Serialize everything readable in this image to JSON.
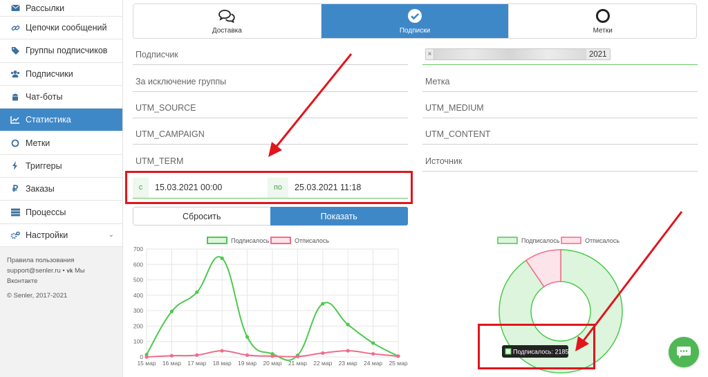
{
  "sidebar": {
    "items": [
      {
        "label": "Рассылки",
        "icon": "envelope-icon"
      },
      {
        "label": "Цепочки сообщений",
        "icon": "link-icon"
      },
      {
        "label": "Группы подписчиков",
        "icon": "tags-icon"
      },
      {
        "label": "Подписчики",
        "icon": "users-icon"
      },
      {
        "label": "Чат-боты",
        "icon": "android-icon"
      },
      {
        "label": "Статистика",
        "icon": "line-chart-icon",
        "active": true
      },
      {
        "label": "Метки",
        "icon": "circle-icon"
      },
      {
        "label": "Триггеры",
        "icon": "bolt-icon"
      },
      {
        "label": "Заказы",
        "icon": "ruble-icon"
      },
      {
        "label": "Процессы",
        "icon": "list-icon"
      },
      {
        "label": "Настройки",
        "icon": "gears-icon"
      }
    ],
    "footer": {
      "terms": "Правила пользования",
      "support": "support@senler.ru",
      "vk": "Мы Вконтакте",
      "copyright": "© Senler, 2017-2021"
    }
  },
  "tabs": [
    {
      "label": "Доставка",
      "icon": "comments-icon"
    },
    {
      "label": "Подписки",
      "icon": "check-circle-icon",
      "active": true
    },
    {
      "label": "Метки",
      "icon": "circle-outline-icon"
    }
  ],
  "filters": {
    "subscriber": "Подписчик",
    "group_chip_tail": "2021",
    "exclude_group": "За исключение группы",
    "tag": "Метка",
    "utm_source": "UTM_SOURCE",
    "utm_medium": "UTM_MEDIUM",
    "utm_campaign": "UTM_CAMPAIGN",
    "utm_content": "UTM_CONTENT",
    "utm_term": "UTM_TERM",
    "source": "Источник"
  },
  "date_range": {
    "from_addon": "с",
    "from_value": "15.03.2021 00:00",
    "to_addon": "по",
    "to_value": "25.03.2021 11:18"
  },
  "buttons": {
    "reset": "Сбросить",
    "show": "Показать"
  },
  "colors": {
    "accent": "#3f88c8",
    "subscribed": "#4cc94c",
    "unsubscribed": "#f06c8a",
    "annotation": "#e1151c",
    "chat": "#4fb854"
  },
  "chart_data": [
    {
      "type": "line",
      "categories": [
        "15 мар",
        "16 мар",
        "17 мар",
        "18 мар",
        "19 мар",
        "20 мар",
        "21 мар",
        "22 мар",
        "23 мар",
        "24 мар",
        "25 мар"
      ],
      "series": [
        {
          "name": "Подписалось",
          "values": [
            15,
            295,
            420,
            640,
            130,
            20,
            10,
            345,
            210,
            90,
            5
          ]
        },
        {
          "name": "Отписалось",
          "values": [
            0,
            8,
            12,
            40,
            12,
            5,
            3,
            25,
            40,
            20,
            5
          ]
        }
      ],
      "ylim": [
        0,
        700
      ],
      "yticks": [
        0,
        100,
        200,
        300,
        400,
        500,
        600,
        700
      ],
      "grid": true,
      "legend": "top"
    },
    {
      "type": "pie",
      "donut": true,
      "labels": [
        "Подписалось",
        "Отписалось"
      ],
      "values": [
        2185,
        230
      ],
      "legend": "top",
      "tooltip": "Подписалось: 2185"
    }
  ]
}
